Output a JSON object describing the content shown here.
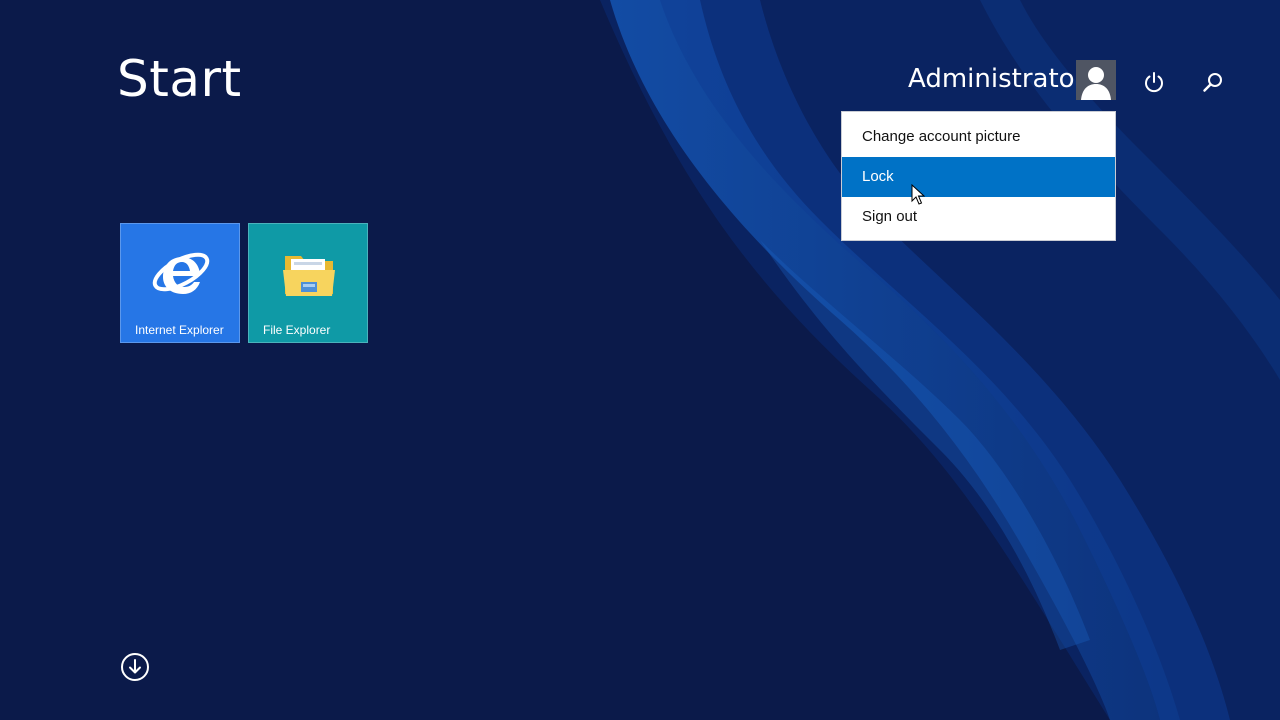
{
  "screen": {
    "title": "Start"
  },
  "account": {
    "user_name": "Administrator",
    "avatar_icon": "user-avatar-icon"
  },
  "top_controls": {
    "power_icon": "power-icon",
    "search_icon": "search-icon"
  },
  "account_menu": {
    "items": [
      {
        "label": "Change account picture",
        "active": false
      },
      {
        "label": "Lock",
        "active": true
      },
      {
        "label": "Sign out",
        "active": false
      }
    ]
  },
  "tiles": [
    {
      "label": "Internet Explorer",
      "icon": "internet-explorer-icon",
      "color": "#2676e6"
    },
    {
      "label": "File Explorer",
      "icon": "file-explorer-icon",
      "color": "#0f9aa6"
    }
  ],
  "bottom": {
    "apps_arrow_icon": "down-arrow-icon"
  },
  "colors": {
    "background": "#0b1a4a",
    "menu_highlight": "#0072c6"
  }
}
